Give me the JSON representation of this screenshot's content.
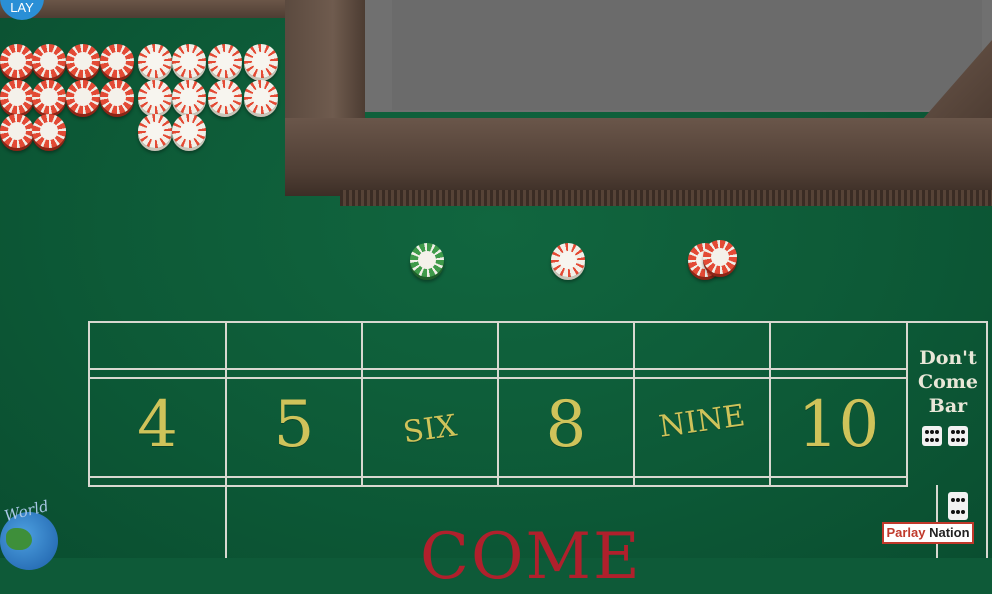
{
  "lay_badge": "LAY",
  "place_numbers": [
    "4",
    "5",
    "SIX",
    "8",
    "NINE",
    "10"
  ],
  "dont_come_bar": "Don't Come Bar",
  "come_label": "COME",
  "world_label": "World",
  "brand": {
    "part1": "Parlay",
    "part2": "Nation"
  },
  "colors": {
    "felt": "#0e5a38",
    "numbers": "#cfc35a",
    "come": "#b0202c",
    "rail": "#5b4a3f"
  },
  "chips_on_layout": [
    "green-chip",
    "white-chip",
    "red-chip-stack"
  ]
}
